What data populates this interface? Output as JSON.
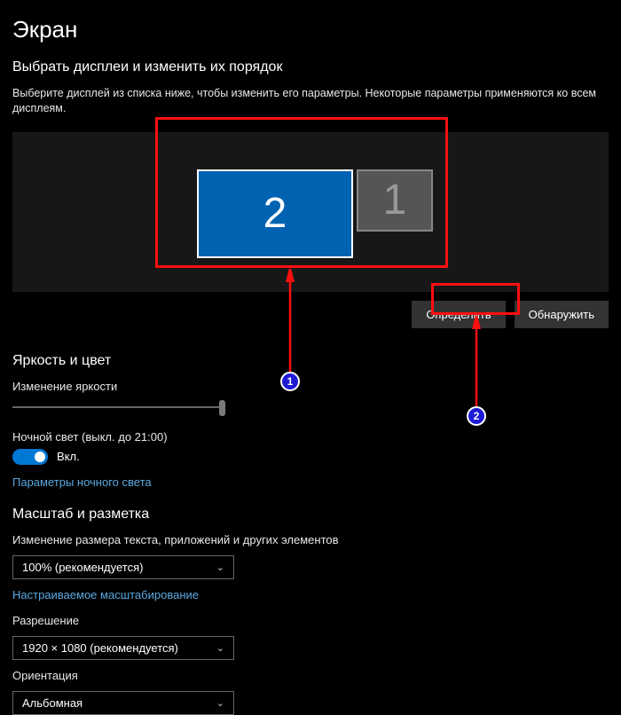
{
  "page": {
    "title": "Экран"
  },
  "arrange": {
    "heading": "Выбрать дисплеи и изменить их порядок",
    "help": "Выберите дисплей из списка ниже, чтобы изменить его параметры. Некоторые параметры применяются ко всем дисплеям.",
    "monitor1_label": "1",
    "monitor2_label": "2",
    "identify_button": "Определить",
    "detect_button": "Обнаружить"
  },
  "brightness": {
    "heading": "Яркость и цвет",
    "slider_label": "Изменение яркости",
    "night_light_label": "Ночной свет (выкл. до 21:00)",
    "toggle_state": "Вкл.",
    "night_light_settings_link": "Параметры ночного света"
  },
  "scale": {
    "heading": "Масштаб и разметка",
    "text_size_label": "Изменение размера текста, приложений и других элементов",
    "text_size_value": "100% (рекомендуется)",
    "custom_scaling_link": "Настраиваемое масштабирование",
    "resolution_label": "Разрешение",
    "resolution_value": "1920 × 1080 (рекомендуется)",
    "orientation_label": "Ориентация",
    "orientation_value": "Альбомная"
  },
  "annotations": {
    "badge1": "1",
    "badge2": "2"
  }
}
